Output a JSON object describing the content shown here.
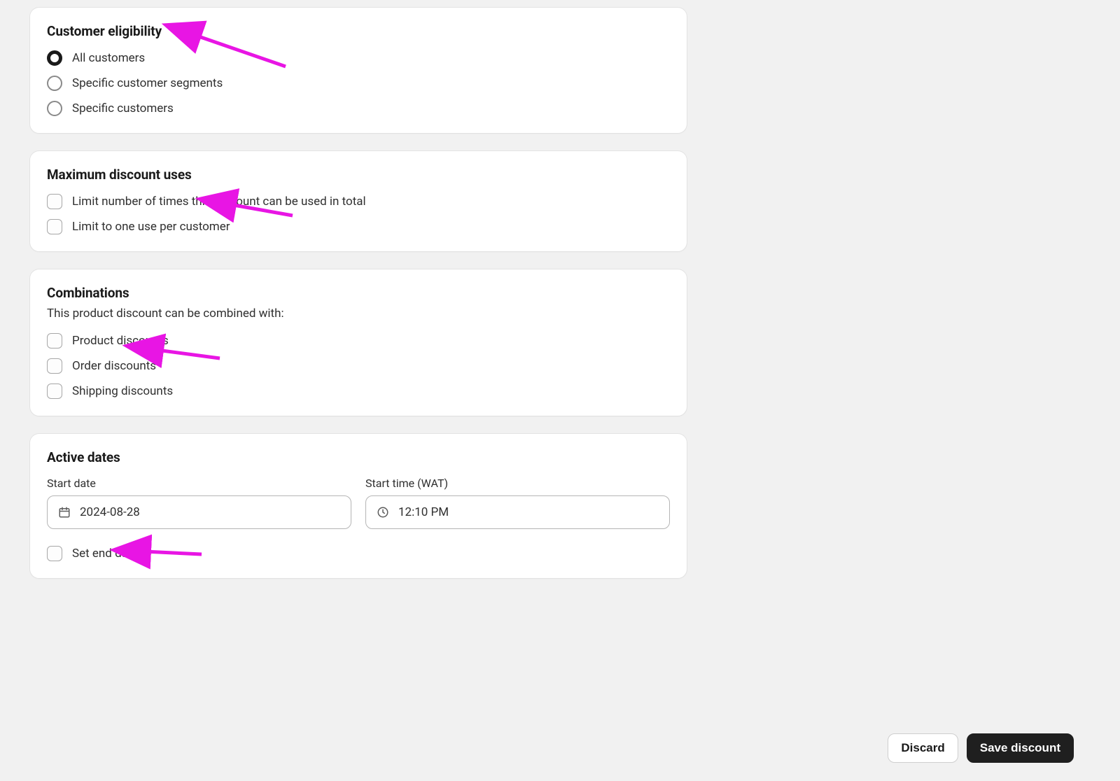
{
  "annotation_color": "#e815e4",
  "customer_eligibility": {
    "title": "Customer eligibility",
    "options": [
      {
        "label": "All customers",
        "selected": true
      },
      {
        "label": "Specific customer segments",
        "selected": false
      },
      {
        "label": "Specific customers",
        "selected": false
      }
    ]
  },
  "max_uses": {
    "title": "Maximum discount uses",
    "options": [
      {
        "label": "Limit number of times this discount can be used in total",
        "checked": false
      },
      {
        "label": "Limit to one use per customer",
        "checked": false
      }
    ]
  },
  "combinations": {
    "title": "Combinations",
    "subtitle": "This product discount can be combined with:",
    "options": [
      {
        "label": "Product discounts",
        "checked": false
      },
      {
        "label": "Order discounts",
        "checked": false
      },
      {
        "label": "Shipping discounts",
        "checked": false
      }
    ]
  },
  "active_dates": {
    "title": "Active dates",
    "start_date_label": "Start date",
    "start_date_value": "2024-08-28",
    "start_time_label": "Start time (WAT)",
    "start_time_value": "12:10 PM",
    "set_end_date_label": "Set end date",
    "set_end_date_checked": false
  },
  "actions": {
    "discard": "Discard",
    "save": "Save discount"
  }
}
